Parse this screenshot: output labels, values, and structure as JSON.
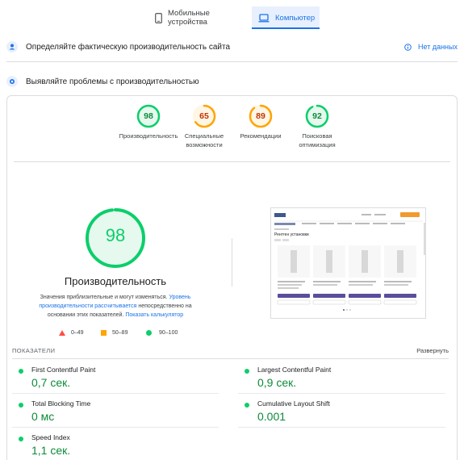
{
  "tabs": {
    "mobile": "Мобильные устройства",
    "desktop": "Компьютер"
  },
  "sections": {
    "field_title": "Определяйте фактическую производительность сайта",
    "no_data": "Нет данных",
    "lab_title": "Выявляйте проблемы с производительностью"
  },
  "scores": [
    {
      "value": "98",
      "label": "Производительность",
      "color": "#0cce6b"
    },
    {
      "value": "65",
      "label": "Специальные возможности",
      "color": "#ffa400"
    },
    {
      "value": "89",
      "label": "Рекомендации",
      "color": "#ffa400"
    },
    {
      "value": "92",
      "label": "Поисковая оптимизация",
      "color": "#0cce6b"
    }
  ],
  "performance": {
    "score": "98",
    "score_fraction": 0.98,
    "title": "Производительность",
    "note_prefix": "Значения приблизительные и могут изменяться.",
    "note_link": "Уровень производительности рассчитывается",
    "note_middle": "непосредственно на основании этих показателей.",
    "note_calc": "Показать калькулятор"
  },
  "legend": {
    "bad": "0–49",
    "average": "50–89",
    "good": "90–100"
  },
  "metrics_header": {
    "title": "ПОКАЗАТЕЛИ",
    "expand": "Развернуть"
  },
  "metrics": [
    {
      "name": "First Contentful Paint",
      "value": "0,7 сек."
    },
    {
      "name": "Largest Contentful Paint",
      "value": "0,9 сек."
    },
    {
      "name": "Total Blocking Time",
      "value": "0 мс"
    },
    {
      "name": "Cumulative Layout Shift",
      "value": "0.001"
    },
    {
      "name": "Speed Index",
      "value": "1,1 сек."
    }
  ],
  "screenshot": {
    "heading": "Рентген установки",
    "button": "Подробнее"
  },
  "colors": {
    "good": "#0cce6b",
    "average": "#ffa400",
    "bad": "#ff4e42",
    "link": "#1a73e8"
  }
}
